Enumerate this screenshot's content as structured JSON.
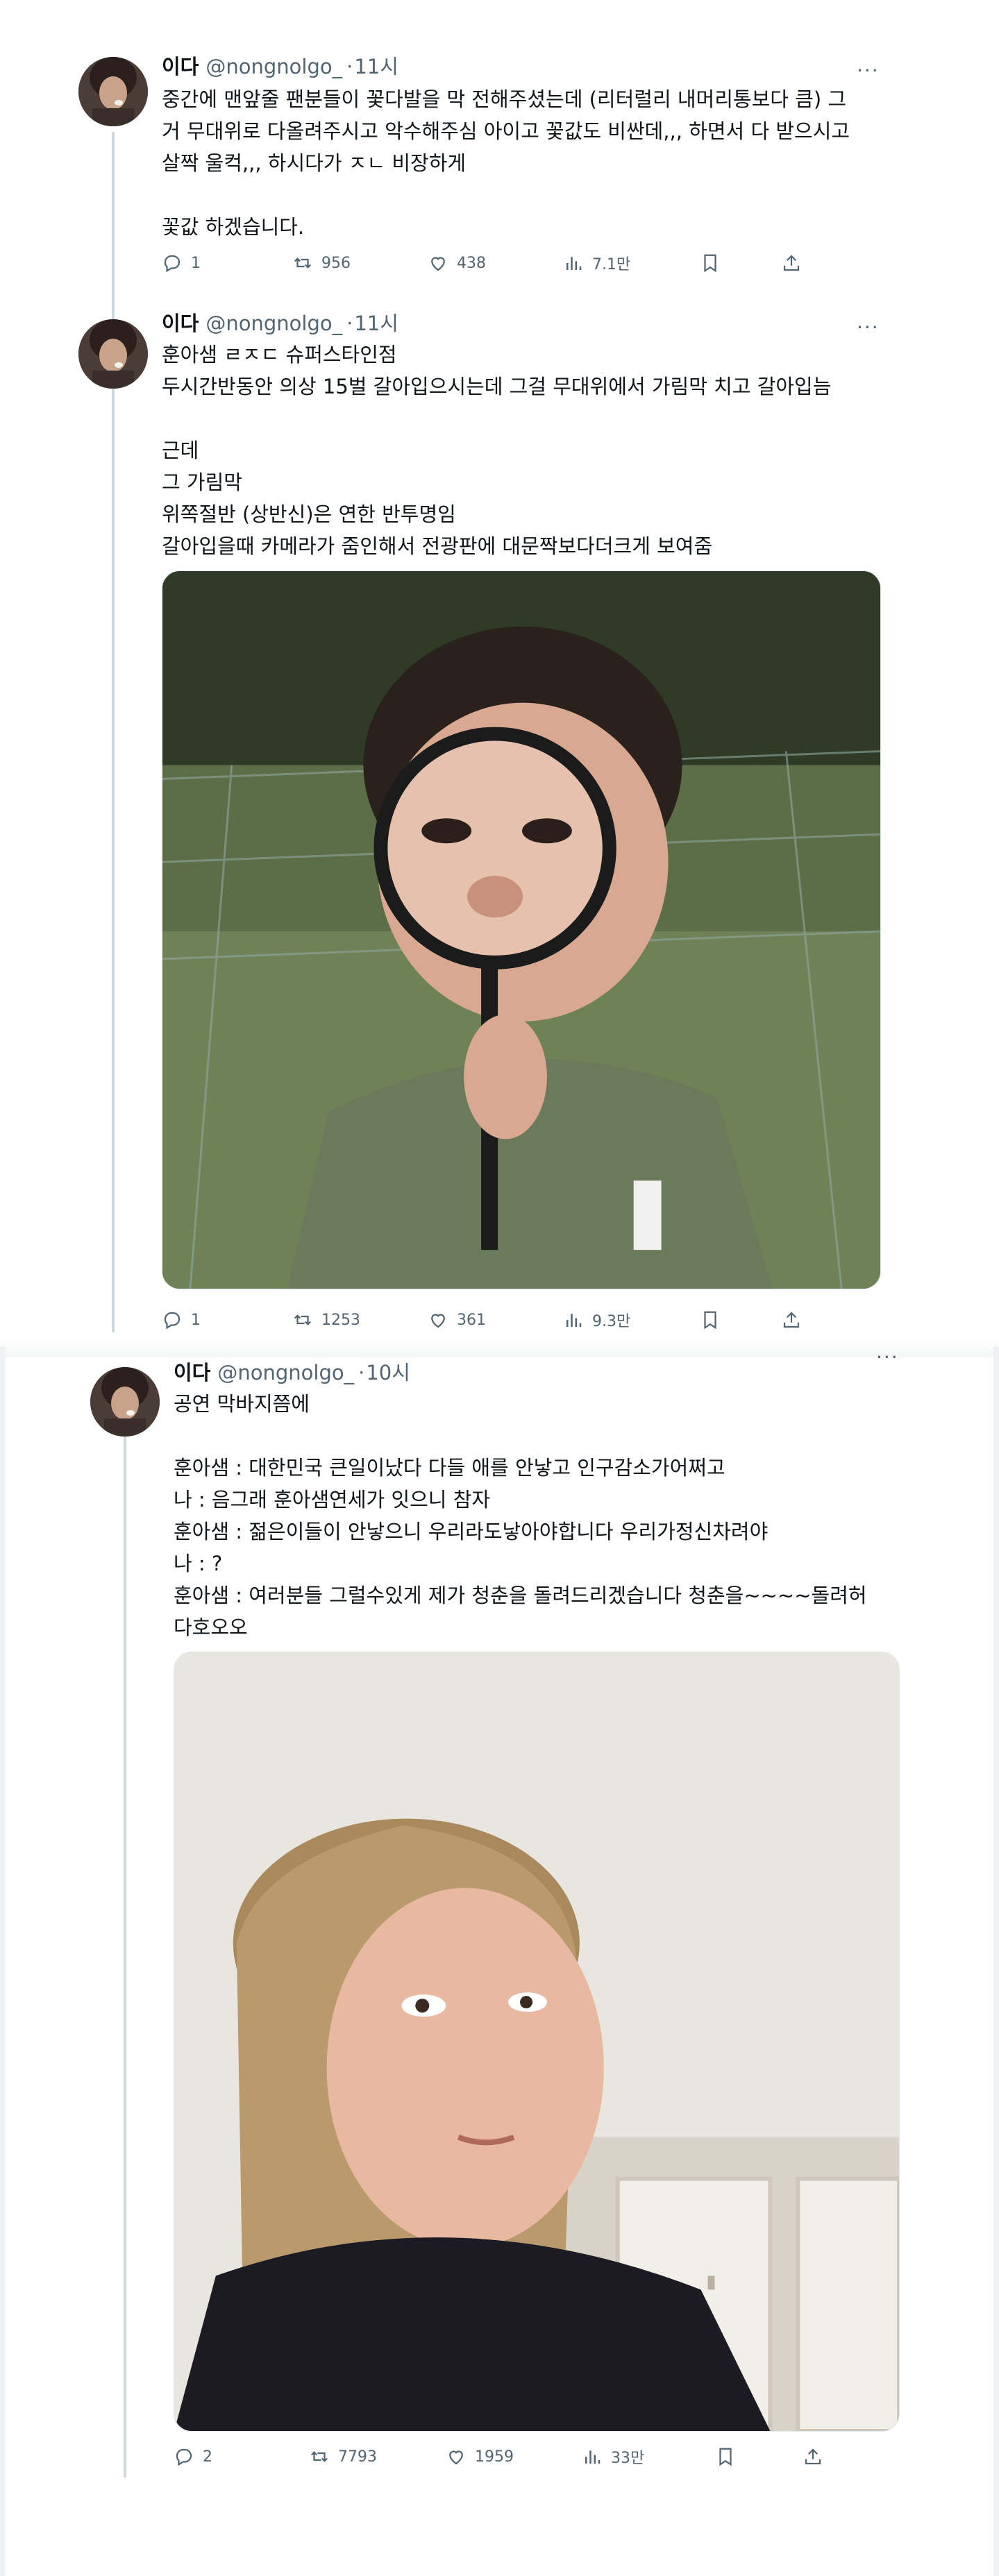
{
  "tweets": [
    {
      "display_name": "이다",
      "handle": "@nongnolgo_",
      "time": "11시",
      "more": "···",
      "body": "중간에 맨앞줄 팬분들이 꽃다발을 막 전해주셨는데 (리터럴리 내머리통보다 큼) 그\n거 무대위로 다올려주시고 악수해주심 아이고 꽃값도 비싼데,,, 하면서 다 받으시고\n살짝 울컥,,, 하시다가 ㅈㄴ 비장하게\n\n꽃값 하겠습니다.",
      "stats": {
        "replies": "1",
        "retweets": "956",
        "likes": "438",
        "views": "7.1만"
      },
      "icons": [
        "reply-icon",
        "retweet-icon",
        "like-icon",
        "views-icon",
        "bookmark-icon",
        "share-icon"
      ]
    },
    {
      "display_name": "이다",
      "handle": "@nongnolgo_",
      "time": "11시",
      "more": "···",
      "body": "훈아샘 ㄹㅈㄷ 슈퍼스타인점\n두시간반동안 의상 15벌 갈아입으시는데 그걸 무대위에서 가림막 치고 갈아입늠\n\n근데\n그 가림막\n위쪽절반 (상반신)은 연한 반투명임\n갈아입을때 카메라가 줌인해서 전광판에 대문짝보다더크게 보여줌",
      "stats": {
        "replies": "1",
        "retweets": "1253",
        "likes": "361",
        "views": "9.3만"
      },
      "icons": [
        "reply-icon",
        "retweet-icon",
        "like-icon",
        "views-icon",
        "bookmark-icon",
        "share-icon"
      ]
    },
    {
      "display_name": "이다",
      "handle": "@nongnolgo_",
      "time": "10시",
      "more": "···",
      "body": "공연 막바지쯤에\n\n훈아샘 : 대한민국 큰일이났다 다들 애를 안낳고 인구감소가어쩌고\n나 : 음그래 훈아샘연세가 잇으니 참자\n훈아샘 : 젊은이들이 안낳으니 우리라도낳아야합니다 우리가정신차려야\n나 : ?\n훈아샘 : 여러분들 그럴수있게 제가 청춘을 돌려드리겠습니다 청춘을~~~~돌려허\n다호오오",
      "stats": {
        "replies": "2",
        "retweets": "7793",
        "likes": "1959",
        "views": "33만"
      },
      "icons": [
        "reply-icon",
        "retweet-icon",
        "like-icon",
        "views-icon",
        "bookmark-icon",
        "share-icon"
      ]
    }
  ],
  "colors": {
    "text": "#0f1419",
    "secondary": "#536471",
    "line": "#cfd9de"
  }
}
